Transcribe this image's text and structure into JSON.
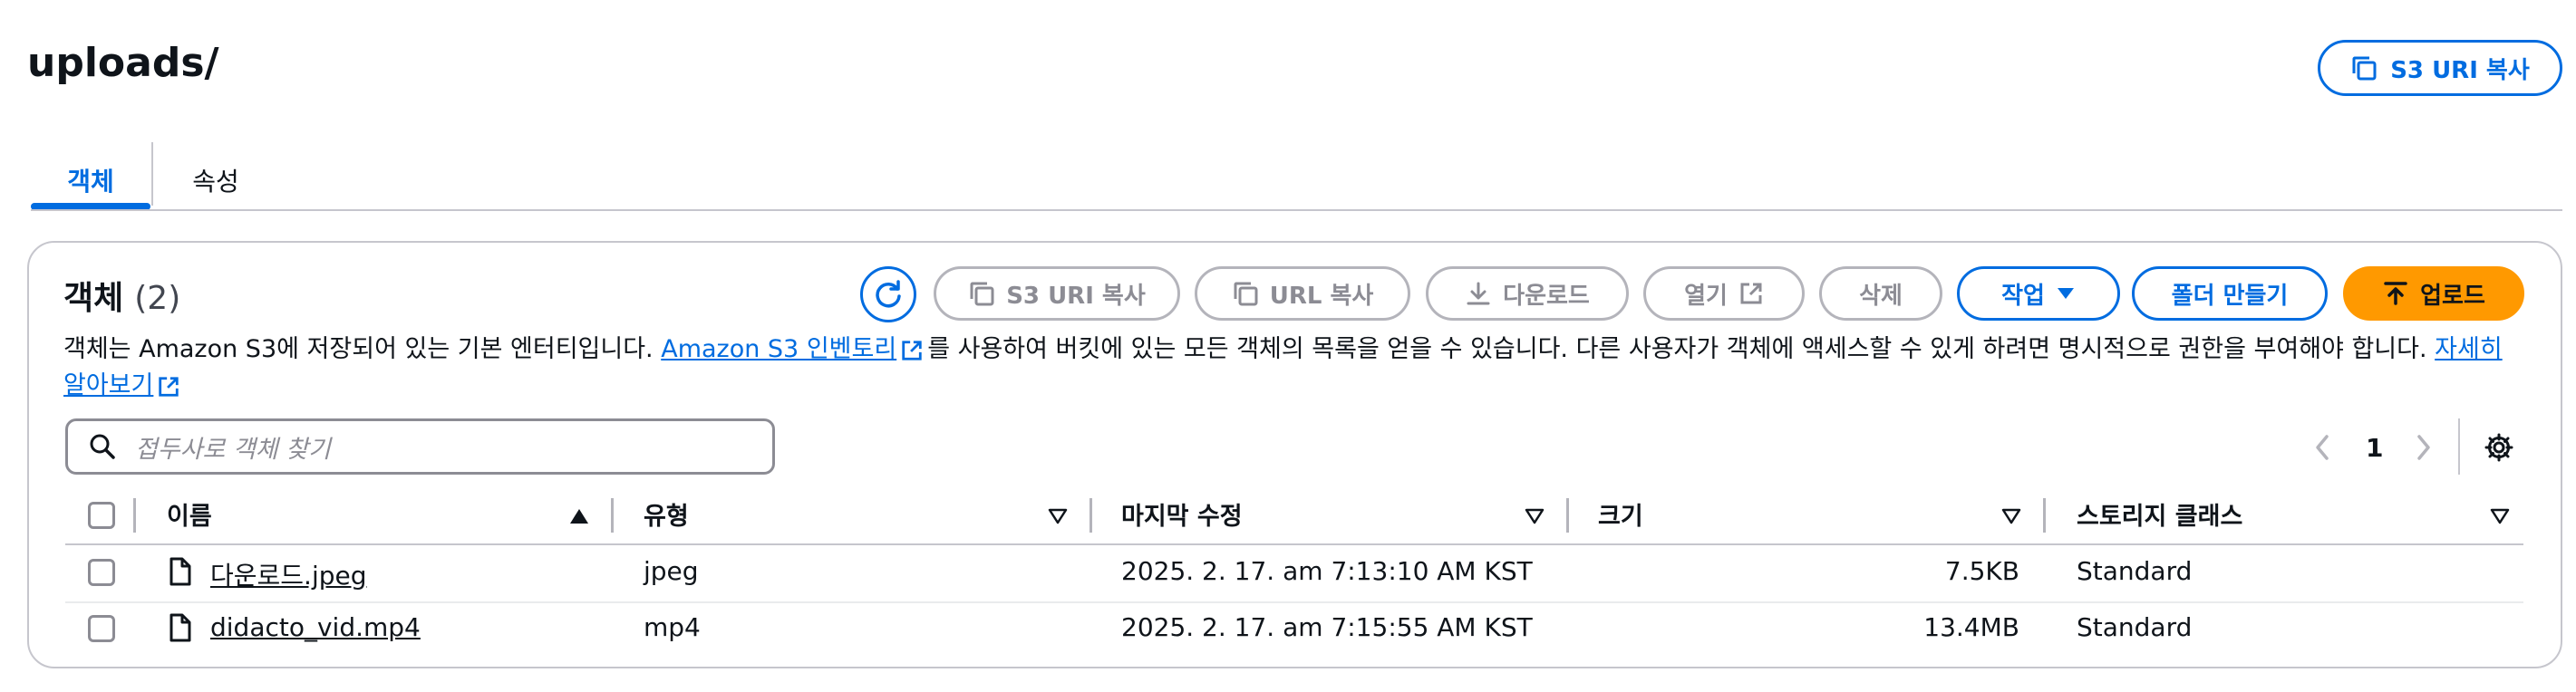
{
  "page": {
    "title": "uploads/",
    "copy_s3_uri_label": "S3 URI 복사"
  },
  "tabs": [
    {
      "label": "객체",
      "active": true
    },
    {
      "label": "속성",
      "active": false
    }
  ],
  "objects_panel": {
    "title": "객체",
    "count": "(2)",
    "toolbar": {
      "copy_s3_uri": "S3 URI 복사",
      "copy_url": "URL 복사",
      "download": "다운로드",
      "open": "열기",
      "delete": "삭제",
      "actions": "작업",
      "create_folder": "폴더 만들기",
      "upload": "업로드"
    },
    "description": {
      "part1": "객체는 Amazon S3에 저장되어 있는 기본 엔터티입니다. ",
      "inventory_link": "Amazon S3 인벤토리",
      "part2": "를 사용하여 버킷에 있는 모든 객체의 목록을 얻을 수 있습니다. 다른 사용자가 객체에 액세스할 수 있게 하려면 명시적으로 권한을 부여해야 합니다. ",
      "learn_more_link": "자세히 알아보기"
    },
    "search": {
      "placeholder": "접두사로 객체 찾기"
    },
    "pagination": {
      "current_page": "1"
    },
    "table": {
      "columns": [
        "이름",
        "유형",
        "마지막 수정",
        "크기",
        "스토리지 클래스"
      ],
      "rows": [
        {
          "name": "다운로드.jpeg",
          "type": "jpeg",
          "last_modified": "2025. 2. 17. am 7:13:10 AM KST",
          "size": "7.5KB",
          "storage_class": "Standard"
        },
        {
          "name": "didacto_vid.mp4",
          "type": "mp4",
          "last_modified": "2025. 2. 17. am 7:15:55 AM KST",
          "size": "13.4MB",
          "storage_class": "Standard"
        }
      ]
    }
  },
  "colors": {
    "accent": "#006ce0",
    "primary_button": "#ff9900",
    "disabled": "#8c8c94",
    "border": "#c6c6cd"
  },
  "icons": {
    "copy": "copy-icon",
    "refresh": "refresh-icon",
    "download": "download-icon",
    "external": "external-link-icon",
    "caret": "caret-down-icon",
    "upload": "upload-icon",
    "search": "search-icon",
    "file": "file-icon",
    "settings": "gear-icon",
    "prev": "chevron-left-icon",
    "next": "chevron-right-icon",
    "sort": "sort-icon"
  }
}
